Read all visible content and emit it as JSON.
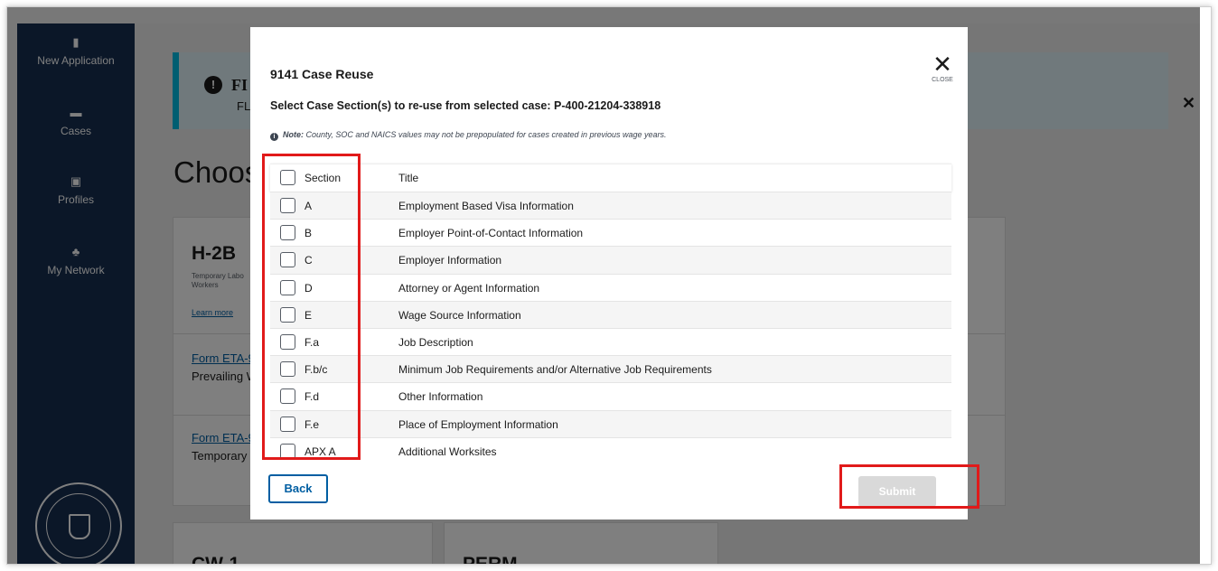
{
  "sidebar": {
    "items": [
      {
        "label": "New Application",
        "icon": "file-icon"
      },
      {
        "label": "Cases",
        "icon": "folder-icon"
      },
      {
        "label": "Profiles",
        "icon": "id-card-icon"
      },
      {
        "label": "My Network",
        "icon": "network-icon"
      }
    ],
    "icon_glyphs": [
      "▮",
      "▬",
      "▣",
      "♣"
    ]
  },
  "background": {
    "alert_title": "FI",
    "alert_sub": "FL",
    "choose_heading": "Choos",
    "card": {
      "title": "H-2B",
      "subtitle": "Temporary Labo\nWorkers",
      "learn_more": "Learn more",
      "form1_link": "Form ETA-9",
      "form1_desc": "Prevailing W",
      "form2_link": "Form ETA-9",
      "form2_desc": "Temporary"
    },
    "bottom_cards": [
      "CW-1",
      "PERM"
    ]
  },
  "modal": {
    "title": "9141 Case Reuse",
    "subtitle": "Select Case Section(s) to re-use from selected case: P-400-21204-338918",
    "note_label": "Note:",
    "note_text": " County, SOC and NAICS values may not be prepopulated for cases created in previous wage years.",
    "close_label": "CLOSE",
    "table": {
      "headers": [
        "Section",
        "Title"
      ],
      "rows": [
        {
          "section": "A",
          "title": "Employment Based Visa Information"
        },
        {
          "section": "B",
          "title": "Employer Point-of-Contact Information"
        },
        {
          "section": "C",
          "title": "Employer Information"
        },
        {
          "section": "D",
          "title": "Attorney or Agent Information"
        },
        {
          "section": "E",
          "title": "Wage Source Information"
        },
        {
          "section": "F.a",
          "title": "Job Description"
        },
        {
          "section": "F.b/c",
          "title": "Minimum Job Requirements and/or Alternative Job Requirements"
        },
        {
          "section": "F.d",
          "title": "Other Information"
        },
        {
          "section": "F.e",
          "title": "Place of Employment Information"
        },
        {
          "section": "APX A",
          "title": "Additional Worksites"
        }
      ]
    },
    "back_label": "Back",
    "submit_label": "Submit",
    "submit_enabled": false
  },
  "colors": {
    "sidebar": "#162e51",
    "primary": "#005ea2",
    "highlight": "#e11a1a",
    "alert_border": "#00bde3",
    "submit_disabled": "#d9d9d9"
  }
}
